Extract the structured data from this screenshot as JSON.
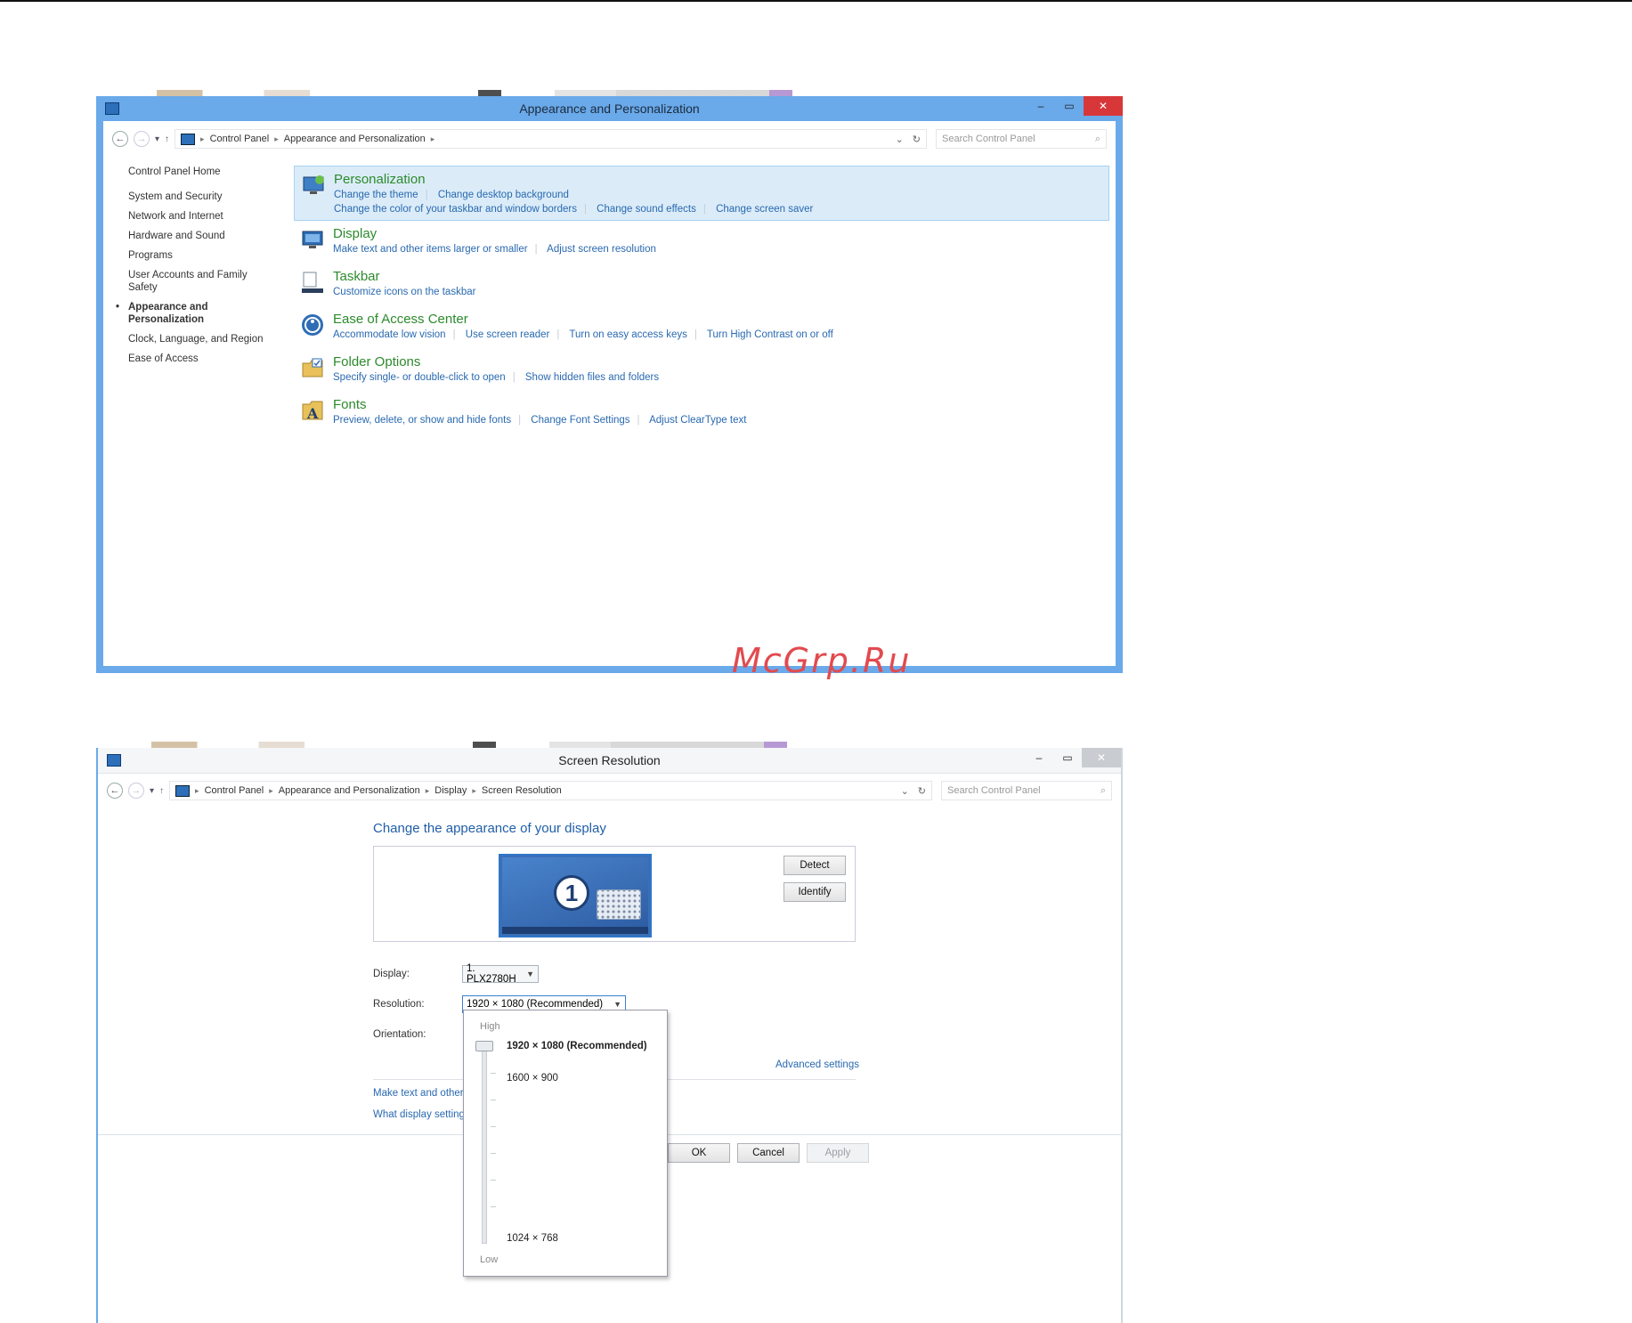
{
  "window1": {
    "title": "Appearance and Personalization",
    "breadcrumb": [
      "Control Panel",
      "Appearance and Personalization"
    ],
    "search_placeholder": "Search Control Panel",
    "left_nav": [
      "Control Panel Home",
      "System and Security",
      "Network and Internet",
      "Hardware and Sound",
      "Programs",
      "User Accounts and Family Safety",
      "Appearance and Personalization",
      "Clock, Language, and Region",
      "Ease of Access"
    ],
    "categories": [
      {
        "title": "Personalization",
        "icon": "personalization-icon",
        "links": [
          "Change the theme",
          "Change desktop background",
          "Change the color of your taskbar and window borders",
          "Change sound effects",
          "Change screen saver"
        ]
      },
      {
        "title": "Display",
        "icon": "display-icon",
        "links": [
          "Make text and other items larger or smaller",
          "Adjust screen resolution"
        ]
      },
      {
        "title": "Taskbar",
        "icon": "taskbar-icon",
        "links": [
          "Customize icons on the taskbar"
        ]
      },
      {
        "title": "Ease of Access Center",
        "icon": "ease-of-access-icon",
        "links": [
          "Accommodate low vision",
          "Use screen reader",
          "Turn on easy access keys",
          "Turn High Contrast on or off"
        ]
      },
      {
        "title": "Folder Options",
        "icon": "folder-options-icon",
        "links": [
          "Specify single- or double-click to open",
          "Show hidden files and folders"
        ]
      },
      {
        "title": "Fonts",
        "icon": "fonts-icon",
        "links": [
          "Preview, delete, or show and hide fonts",
          "Change Font Settings",
          "Adjust ClearType text"
        ]
      }
    ]
  },
  "window2": {
    "title": "Screen Resolution",
    "breadcrumb": [
      "Control Panel",
      "Appearance and Personalization",
      "Display",
      "Screen Resolution"
    ],
    "search_placeholder": "Search Control Panel",
    "heading": "Change the appearance of your display",
    "monitor_number": "1",
    "detect": "Detect",
    "identify": "Identify",
    "display_label": "Display:",
    "display_value": "1. PLX2780H",
    "resolution_label": "Resolution:",
    "resolution_value": "1920 × 1080 (Recommended)",
    "orientation_label": "Orientation:",
    "advanced": "Advanced settings",
    "link1": "Make text and other",
    "link2": "What display setting",
    "ok": "OK",
    "cancel": "Cancel",
    "apply": "Apply",
    "dropdown": {
      "high": "High",
      "low": "Low",
      "options": [
        "1920 × 1080 (Recommended)",
        "1600 × 900",
        "1024 × 768"
      ]
    }
  },
  "watermark": "McGrp.Ru"
}
